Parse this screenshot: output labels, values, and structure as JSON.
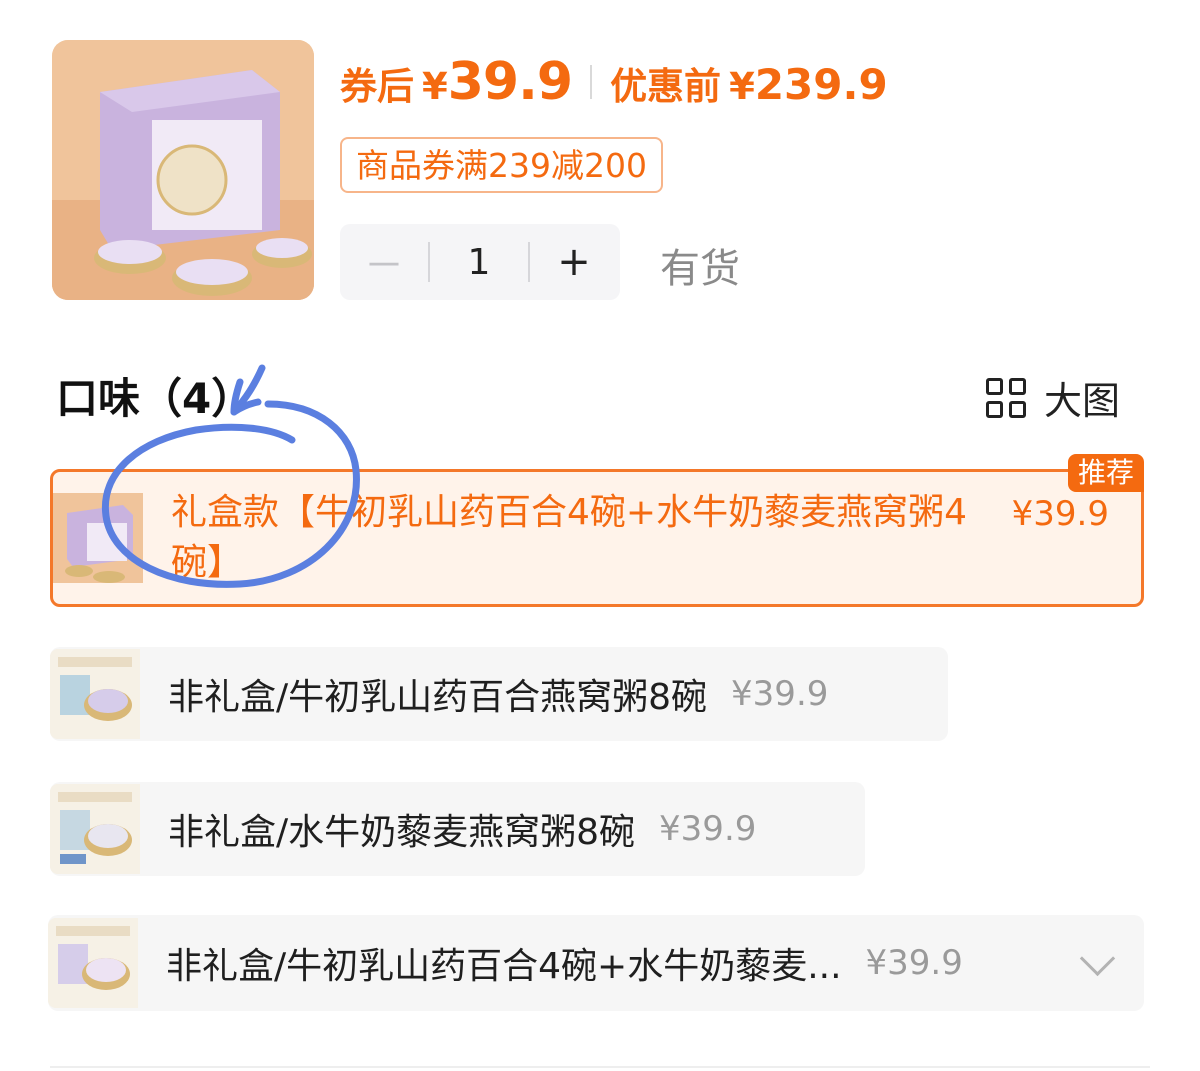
{
  "header": {
    "after_coupon_label": "券后",
    "currency": "¥",
    "after_coupon_price": "39.9",
    "before_discount_label": "优惠前",
    "before_discount_price": "239.9",
    "coupon_text": "商品券满239减200",
    "stock_status": "有货"
  },
  "stepper": {
    "minus_label": "－",
    "quantity": "1",
    "plus_label": "+"
  },
  "flavor_section": {
    "title": "口味（4）",
    "big_view_label": "大图"
  },
  "options": [
    {
      "name": "礼盒款【牛初乳山药百合4碗+水牛奶藜麦燕窝粥4碗】",
      "price": "¥39.9",
      "badge": "推荐",
      "selected": true
    },
    {
      "name": "非礼盒/牛初乳山药百合燕窝粥8碗",
      "price": "¥39.9",
      "selected": false
    },
    {
      "name": "非礼盒/水牛奶藜麦燕窝粥8碗",
      "price": "¥39.9",
      "selected": false
    },
    {
      "name": "非礼盒/牛初乳山药百合4碗+水牛奶藜麦...",
      "price": "¥39.9",
      "selected": false
    }
  ],
  "colors": {
    "accent": "#f46a10",
    "selected_bg": "#fff3ea",
    "annotation_blue": "#5b7fe0"
  },
  "icons": {
    "grid": "grid-icon",
    "chevron": "chevron-down-icon"
  }
}
